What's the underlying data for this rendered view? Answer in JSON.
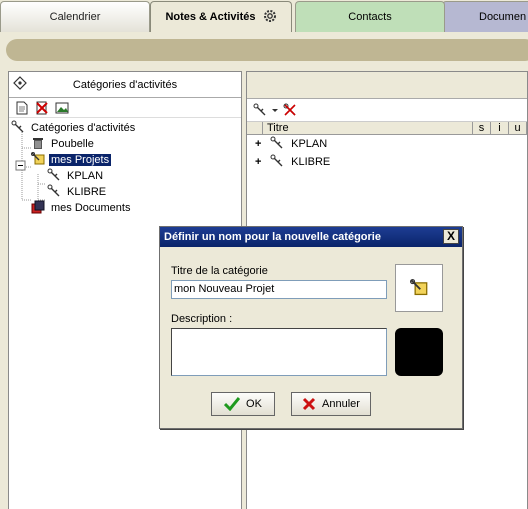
{
  "tabs": [
    {
      "label": "Calendrier"
    },
    {
      "label": "Notes & Activités"
    },
    {
      "label": "Contacts"
    },
    {
      "label": "Documen"
    }
  ],
  "left_panel": {
    "header": "Catégories d'activités",
    "tree": {
      "root": "Catégories d'activités",
      "items": [
        "Poubelle",
        "mes Projets",
        "KPLAN",
        "KLIBRE",
        "mes Documents"
      ]
    }
  },
  "right_panel": {
    "columns": {
      "titre": "Titre",
      "s": "s",
      "i": "i",
      "u": "u"
    },
    "rows": [
      "KPLAN",
      "KLIBRE"
    ]
  },
  "dialog": {
    "title": "Définir un nom pour la nouvelle catégorie",
    "close": "X",
    "title_label": "Titre de la catégorie",
    "title_value": "mon Nouveau Projet",
    "description_label": "Description :",
    "ok_label": "OK",
    "cancel_label": "Annuler",
    "color": "#000000"
  },
  "colors": {
    "selection": "#0a246a",
    "banner": "#bfb693",
    "tab_contacts": "#bfdfb8",
    "tab_documents": "#b6b8d2"
  }
}
